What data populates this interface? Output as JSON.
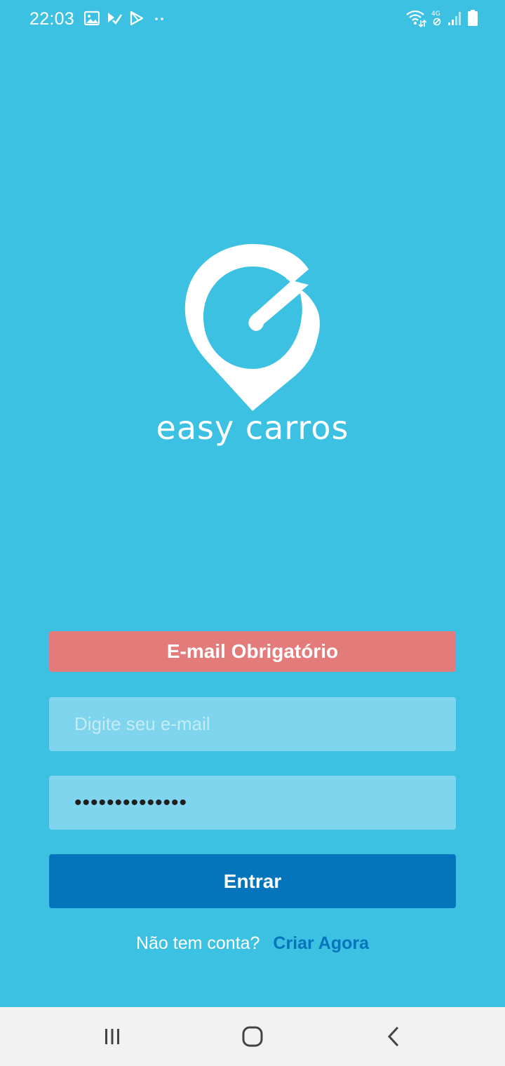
{
  "status_bar": {
    "time": "22:03",
    "left_icons": [
      "gallery-icon",
      "download-check-icon",
      "play-store-icon",
      "more-dots-icon"
    ],
    "right_icons": [
      "wifi-icon",
      "4g-icon",
      "signal-icon",
      "battery-icon"
    ],
    "network_label": "4G"
  },
  "brand": {
    "name": "easy carros",
    "logo_icon": "pin-gauge-logo-icon"
  },
  "form": {
    "error_message": "E-mail Obrigatório",
    "email_placeholder": "Digite seu e-mail",
    "email_value": "",
    "password_value": "••••••••••••••",
    "submit_label": "Entrar"
  },
  "signup": {
    "prompt": "Não tem conta?",
    "link_label": "Criar Agora"
  },
  "nav": {
    "items": [
      "recents-icon",
      "home-icon",
      "back-icon"
    ]
  },
  "colors": {
    "background": "#3dc1e2",
    "error": "#e47b7b",
    "field": "#7ed5ed",
    "primary": "#0474bd"
  }
}
